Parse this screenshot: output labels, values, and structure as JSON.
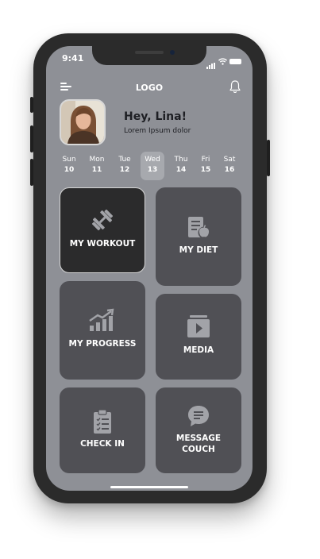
{
  "status_bar": {
    "time": "9:41"
  },
  "header": {
    "logo": "LOGO",
    "menu_icon": "menu-icon",
    "bell_icon": "bell-icon"
  },
  "profile": {
    "greeting": "Hey, Lina!",
    "subtitle": "Lorem Ipsum dolor"
  },
  "days": [
    {
      "name": "Sun",
      "date": "10"
    },
    {
      "name": "Mon",
      "date": "11"
    },
    {
      "name": "Tue",
      "date": "12"
    },
    {
      "name": "Wed",
      "date": "13",
      "selected": true
    },
    {
      "name": "Thu",
      "date": "14"
    },
    {
      "name": "Fri",
      "date": "15"
    },
    {
      "name": "Sat",
      "date": "16"
    }
  ],
  "cards": {
    "workout": {
      "label": "MY WORKOUT",
      "icon": "dumbbell-icon",
      "active": true
    },
    "diet": {
      "label": "MY DIET",
      "icon": "diet-icon"
    },
    "progress": {
      "label": "MY PROGRESS",
      "icon": "progress-chart-icon"
    },
    "media": {
      "label": "MEDIA",
      "icon": "media-play-icon"
    },
    "checkin": {
      "label": "CHECK IN",
      "icon": "clipboard-icon"
    },
    "message": {
      "label_line1": "MESSAGE",
      "label_line2": "COUCH",
      "icon": "chat-icon"
    }
  },
  "colors": {
    "screen_bg": "#8e9096",
    "card_bg": "#505055",
    "card_active_bg": "#2b2b2c",
    "phone_frame": "#2b2b2b",
    "icon_fill": "#a2a3a8"
  }
}
